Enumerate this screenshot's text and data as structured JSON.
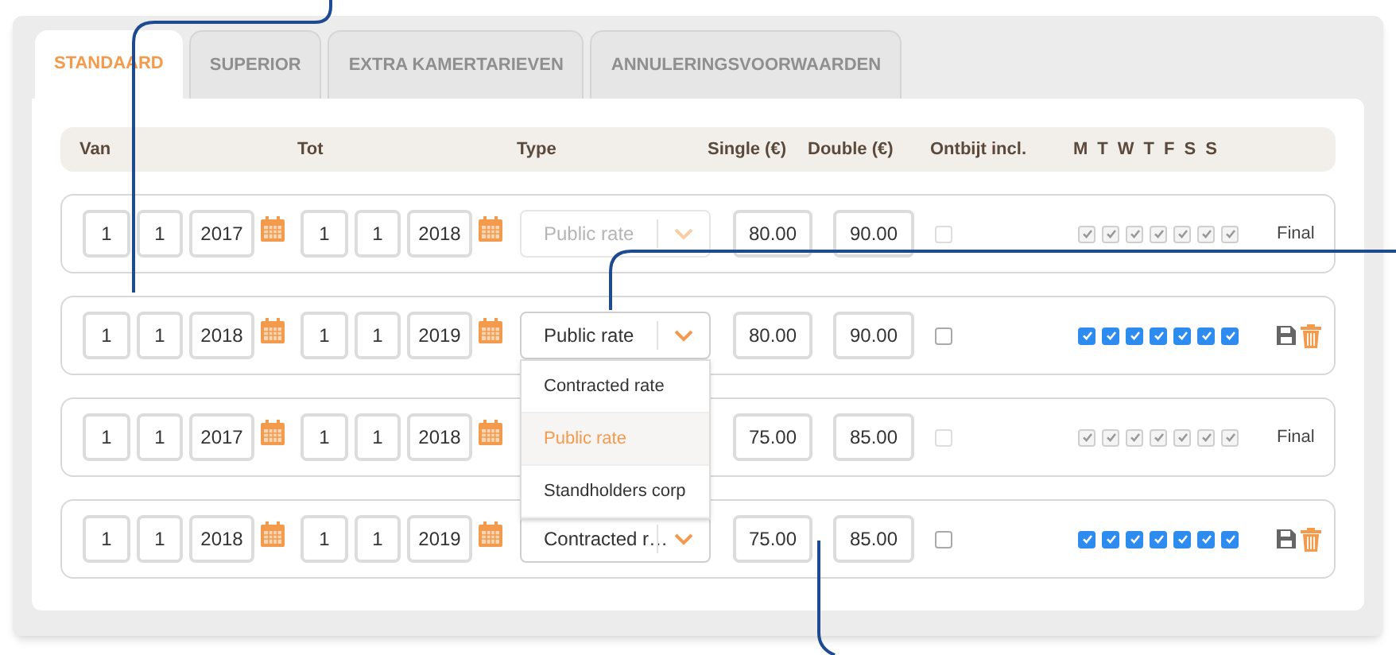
{
  "tabs": [
    {
      "label": "STANDAARD",
      "selected": true
    },
    {
      "label": "SUPERIOR",
      "selected": false
    },
    {
      "label": "EXTRA KAMERTARIEVEN",
      "selected": false
    },
    {
      "label": "ANNULERINGSVOORWAARDEN",
      "selected": false
    }
  ],
  "table": {
    "columns": [
      "Van",
      "Tot",
      "Type",
      "Single (€)",
      "Double (€)",
      "Ontbijt incl."
    ],
    "days": [
      "M",
      "T",
      "W",
      "T",
      "F",
      "S",
      "S"
    ],
    "rows": [
      {
        "kind": "final",
        "from": [
          "1",
          "1",
          "2017"
        ],
        "to": [
          "1",
          "1",
          "2018"
        ],
        "type": "Public rate",
        "single": "80.00",
        "double": "90.00",
        "breakfast": false,
        "days": [
          true,
          true,
          true,
          true,
          true,
          true,
          true
        ],
        "status": "Final"
      },
      {
        "kind": "editable",
        "from": [
          "1",
          "1",
          "2018"
        ],
        "to": [
          "1",
          "1",
          "2019"
        ],
        "type": "Public rate",
        "single": "80.00",
        "double": "90.00",
        "breakfast": false,
        "days": [
          true,
          true,
          true,
          true,
          true,
          true,
          true
        ],
        "dropdown": [
          {
            "label": "Contracted rate",
            "selected": false
          },
          {
            "label": "Public rate",
            "selected": true
          },
          {
            "label": "Standholders corp",
            "selected": false
          }
        ]
      },
      {
        "kind": "final",
        "from": [
          "1",
          "1",
          "2017"
        ],
        "to": [
          "1",
          "1",
          "2018"
        ],
        "single": "75.00",
        "double": "85.00",
        "breakfast": false,
        "days": [
          true,
          true,
          true,
          true,
          true,
          true,
          true
        ],
        "status": "Final"
      },
      {
        "kind": "editable",
        "from": [
          "1",
          "1",
          "2018"
        ],
        "to": [
          "1",
          "1",
          "2019"
        ],
        "type": "Contracted r…",
        "single": "75.00",
        "double": "85.00",
        "breakfast": false,
        "days": [
          true,
          true,
          true,
          true,
          true,
          true,
          true
        ]
      }
    ]
  }
}
